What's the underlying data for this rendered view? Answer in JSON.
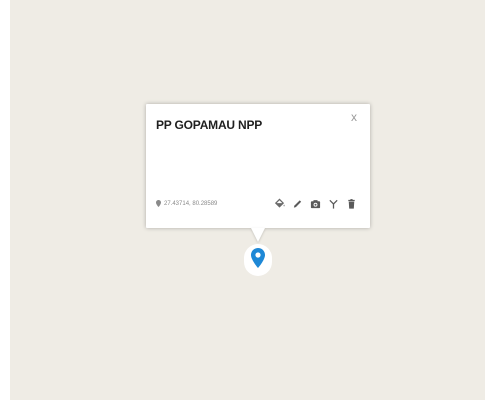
{
  "popup": {
    "title": "PP GOPAMAU NPP",
    "close_label": "x",
    "coordinates": "27.43714, 80.28589"
  },
  "toolbar": {
    "icons": [
      "paint-bucket-icon",
      "pencil-icon",
      "camera-icon",
      "antenna-icon",
      "trash-icon"
    ]
  },
  "marker": {
    "icon": "map-pin-icon",
    "color": "#1e88d6"
  },
  "colors": {
    "map_background": "#efece5",
    "popup_background": "#ffffff",
    "icon_color": "#6a6a6a"
  }
}
